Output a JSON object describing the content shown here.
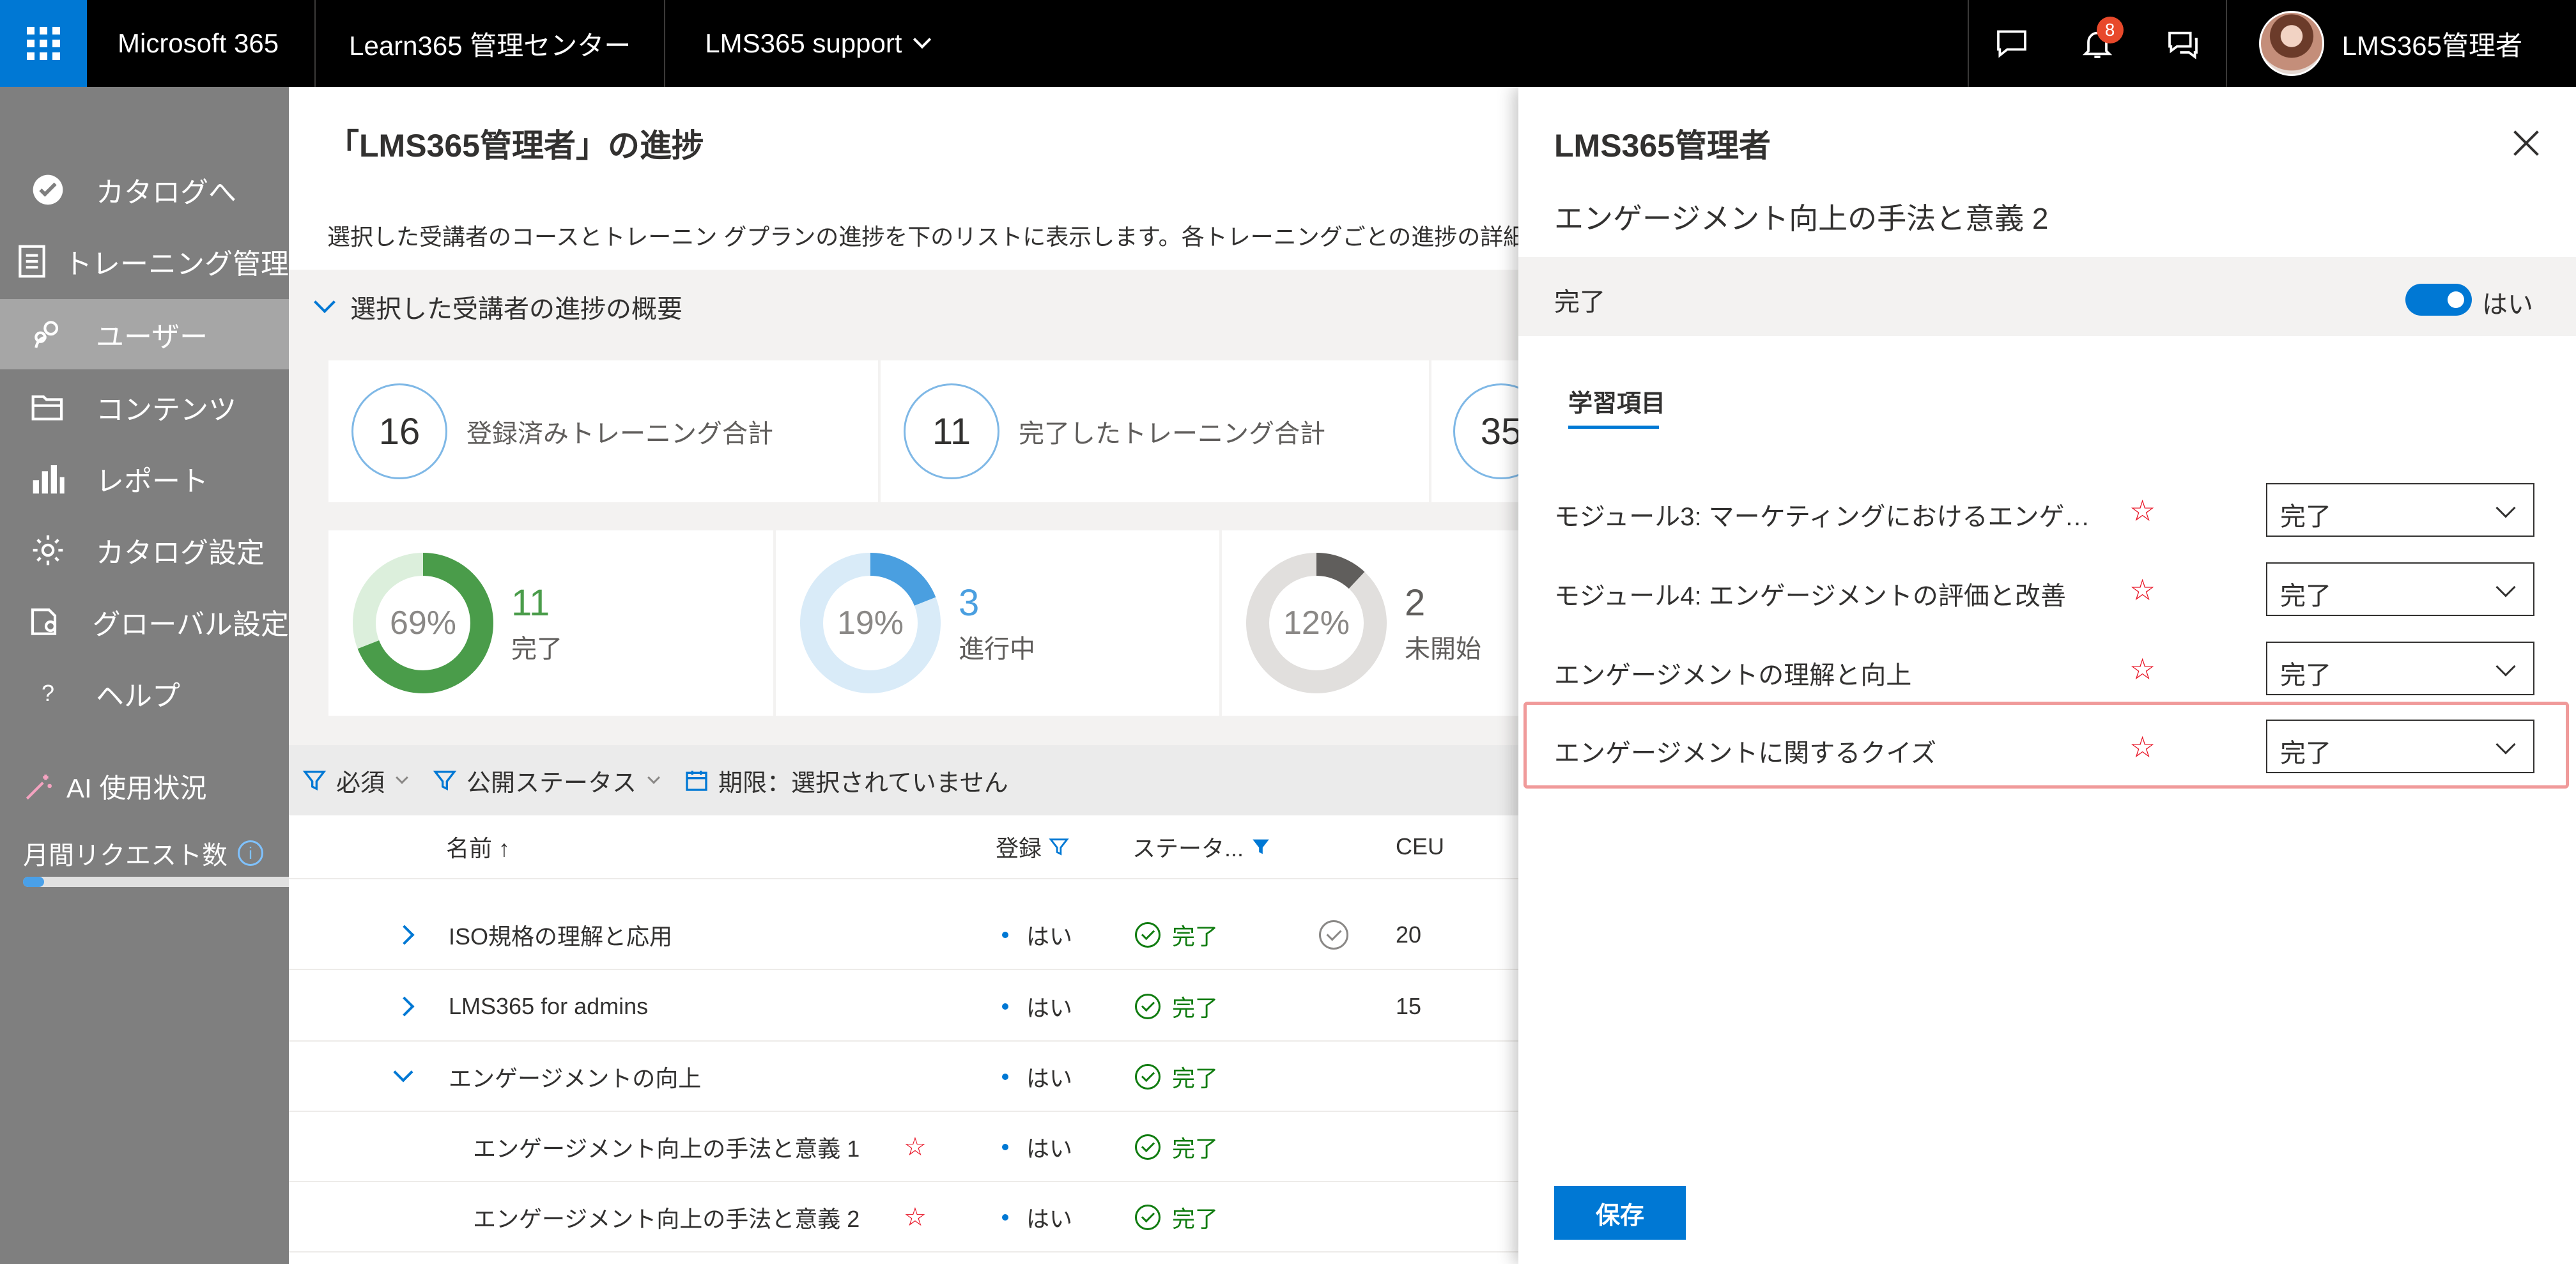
{
  "topbar": {
    "brand": "Microsoft 365",
    "app": "Learn365 管理センター",
    "tenant": "LMS365 support",
    "notification_count": "8",
    "user_name": "LMS365管理者"
  },
  "leftnav": {
    "items": [
      {
        "label": "カタログへ",
        "icon": "check-circle-icon"
      },
      {
        "label": "トレーニング管理",
        "icon": "document-icon"
      },
      {
        "label": "ユーザー",
        "icon": "people-icon"
      },
      {
        "label": "コンテンツ",
        "icon": "folder-icon"
      },
      {
        "label": "レポート",
        "icon": "bar-chart-icon"
      },
      {
        "label": "カタログ設定",
        "icon": "gear-icon"
      },
      {
        "label": "グローバル設定",
        "icon": "settings-doc-icon"
      },
      {
        "label": "ヘルプ",
        "icon": "question-icon"
      }
    ],
    "ai_usage": "AI 使用状況",
    "monthly_requests": "月間リクエスト数",
    "monthly_progress": 0.08
  },
  "main": {
    "title": "「LMS365管理者」の進捗",
    "description": "選択した受講者のコースとトレーニン グプランの進捗を下のリストに表示します。各トレーニングごとの進捗の詳細",
    "summary_header": "選択した受講者の進捗の概要",
    "stats": [
      {
        "value": "16",
        "label": "登録済みトレーニング合計"
      },
      {
        "value": "11",
        "label": "完了したトレーニング合計"
      },
      {
        "value": "35",
        "label": ""
      }
    ],
    "donuts": [
      {
        "pct": "69%",
        "fraction": 0.69,
        "count": "11",
        "label": "完了",
        "color": "#4a9c4a",
        "track": "#dcefdc"
      },
      {
        "pct": "19%",
        "fraction": 0.19,
        "count": "3",
        "label": "進行中",
        "color": "#4a9fe0",
        "track": "#d9ebf8"
      },
      {
        "pct": "12%",
        "fraction": 0.12,
        "count": "2",
        "label": "未開始",
        "color": "#605e5c",
        "track": "#e1dfdd"
      }
    ],
    "filters": {
      "required": "必須",
      "publish_status": "公開ステータス",
      "deadline": "期限：選択されていません"
    },
    "columns": {
      "name": "名前 ↑",
      "enroll": "登録",
      "status": "ステータ...",
      "ceu": "CEU"
    },
    "rows": [
      {
        "name": "ISO規格の理解と応用",
        "enroll": "はい",
        "status": "完了",
        "ceu": "20"
      },
      {
        "name": "LMS365 for admins",
        "enroll": "はい",
        "status": "完了",
        "ceu": "15"
      },
      {
        "name": "エンゲージメントの向上",
        "enroll": "はい",
        "status": "完了",
        "ceu": ""
      },
      {
        "name": "エンゲージメント向上の手法と意義 1",
        "enroll": "はい",
        "status": "完了",
        "ceu": ""
      },
      {
        "name": "エンゲージメント向上の手法と意義 2",
        "enroll": "はい",
        "status": "完了",
        "ceu": ""
      }
    ],
    "star": "☆"
  },
  "panel": {
    "title": "LMS365管理者",
    "subtitle": "エンゲージメント向上の手法と意義 2",
    "complete_label": "完了",
    "toggle_label": "はい",
    "tab": "学習項目",
    "items": [
      {
        "label": "モジュール3: マーケティングにおけるエンゲージメ...",
        "value": "完了"
      },
      {
        "label": "モジュール4: エンゲージメントの評価と改善",
        "value": "完了"
      },
      {
        "label": "エンゲージメントの理解と向上",
        "value": "完了"
      },
      {
        "label": "エンゲージメントに関するクイズ",
        "value": "完了"
      }
    ],
    "star": "☆",
    "save_label": "保存"
  }
}
